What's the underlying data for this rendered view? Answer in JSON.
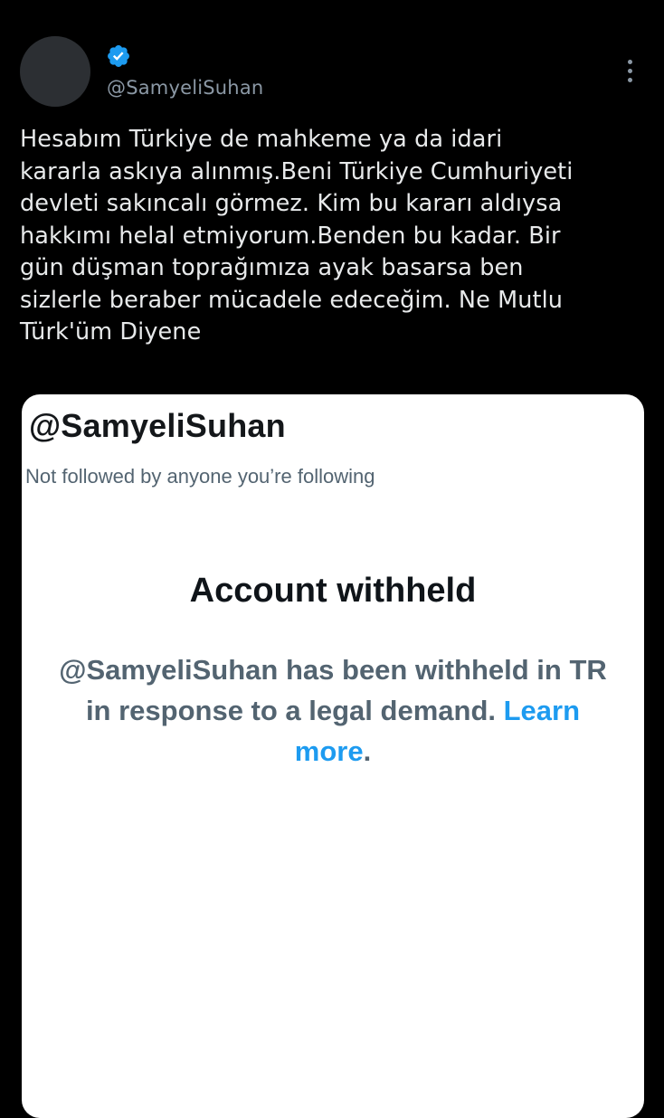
{
  "tweet": {
    "handle": "@SamyeliSuhan",
    "text": "Hesabım Türkiye de mahkeme ya da idari\nkararla askıya alınmış.Beni Türkiye Cumhuriyeti\ndevleti sakıncalı görmez. Kim bu kararı aldıysa\nhakkımı helal etmiyorum.Benden bu kadar. Bir\ngün düşman toprağımıza ayak basarsa ben\nsizlerle beraber mücadele edeceğim. Ne Mutlu\nTürk'üm Diyene",
    "verified": true,
    "icons": [
      "verified-badge-icon",
      "more-options-icon"
    ]
  },
  "card": {
    "handle": "@SamyeliSuhan",
    "subtitle": "Not followed by anyone you’re following",
    "title": "Account withheld",
    "body_prefix": "@SamyeliSuhan has been withheld in TR in response to a legal demand.",
    "link_text": "Learn more",
    "body_suffix": "."
  },
  "colors": {
    "background": "#000000",
    "accent": "#1d9bf0",
    "muted_text": "#536471"
  }
}
